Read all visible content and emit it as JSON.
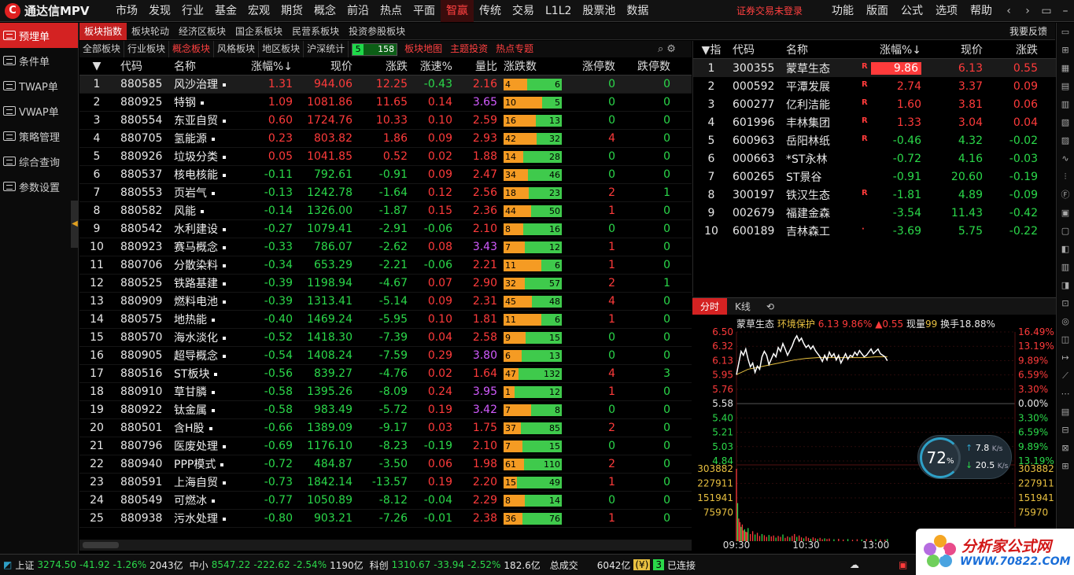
{
  "app": {
    "logo_glyph": "C",
    "title": "通达信MPV"
  },
  "menu": [
    "市场",
    "发现",
    "行业",
    "基金",
    "宏观",
    "期货",
    "概念",
    "前沿",
    "热点",
    "平面",
    "智赢",
    "传统",
    "交易",
    "L1L2",
    "股票池",
    "数据"
  ],
  "menu_active": 10,
  "login_text": "证券交易未登录",
  "right_menu": [
    "功能",
    "版面",
    "公式",
    "选项",
    "帮助"
  ],
  "window_controls": [
    "‹",
    "›",
    "▭",
    "–",
    "□",
    "✕"
  ],
  "sidebar": [
    "预埋单",
    "条件单",
    "TWAP单",
    "VWAP单",
    "策略管理",
    "综合查询",
    "参数设置"
  ],
  "sidebar_handle": "◀",
  "tabs1": [
    "板块指数",
    "板块轮动",
    "经济区板块",
    "国企系板块",
    "民营系板块",
    "投资参股板块"
  ],
  "feedback": "我要反馈",
  "tabs2": [
    "全部板块",
    "行业板块",
    "概念板块",
    "风格板块",
    "地区板块",
    "沪深统计"
  ],
  "tabs2_active": 2,
  "stat": {
    "up": "5",
    "down": "158"
  },
  "tabs2_right": [
    "板块地图",
    "主题投资",
    "热点专题"
  ],
  "tools2": [
    "⌕",
    "⚙"
  ],
  "sector": {
    "headers": [
      "",
      "代码",
      "名称",
      "涨幅%↓",
      "现价",
      "涨跌",
      "涨速%",
      "量比",
      "涨跌数",
      "涨停数",
      "跌停数"
    ],
    "sort_glyph": "▼",
    "rows": [
      [
        "1",
        "880585",
        "风沙治理",
        "1.31",
        "944.06",
        "12.25",
        "-0.43",
        "2.16",
        "4",
        "6",
        "0",
        "0"
      ],
      [
        "2",
        "880925",
        "特钢",
        "1.09",
        "1081.86",
        "11.65",
        "0.14",
        "3.65",
        "10",
        "5",
        "0",
        "0"
      ],
      [
        "3",
        "880554",
        "东亚自贸",
        "0.60",
        "1724.76",
        "10.33",
        "0.10",
        "2.59",
        "16",
        "13",
        "0",
        "0"
      ],
      [
        "4",
        "880705",
        "氢能源",
        "0.23",
        "803.82",
        "1.86",
        "0.09",
        "2.93",
        "42",
        "32",
        "4",
        "0"
      ],
      [
        "5",
        "880926",
        "垃圾分类",
        "0.05",
        "1041.85",
        "0.52",
        "0.02",
        "1.88",
        "14",
        "28",
        "0",
        "0"
      ],
      [
        "6",
        "880537",
        "核电核能",
        "-0.11",
        "792.61",
        "-0.91",
        "0.09",
        "2.47",
        "34",
        "46",
        "0",
        "0"
      ],
      [
        "7",
        "880553",
        "页岩气",
        "-0.13",
        "1242.78",
        "-1.64",
        "0.12",
        "2.56",
        "18",
        "23",
        "2",
        "1"
      ],
      [
        "8",
        "880582",
        "风能",
        "-0.14",
        "1326.00",
        "-1.87",
        "0.15",
        "2.36",
        "44",
        "50",
        "1",
        "0"
      ],
      [
        "9",
        "880542",
        "水利建设",
        "-0.27",
        "1079.41",
        "-2.91",
        "-0.06",
        "2.10",
        "8",
        "16",
        "0",
        "0"
      ],
      [
        "10",
        "880923",
        "赛马概念",
        "-0.33",
        "786.07",
        "-2.62",
        "0.08",
        "3.43",
        "7",
        "12",
        "1",
        "0"
      ],
      [
        "11",
        "880706",
        "分散染料",
        "-0.34",
        "653.29",
        "-2.21",
        "-0.06",
        "2.21",
        "11",
        "6",
        "1",
        "0"
      ],
      [
        "12",
        "880525",
        "铁路基建",
        "-0.39",
        "1198.94",
        "-4.67",
        "0.07",
        "2.90",
        "32",
        "57",
        "2",
        "1"
      ],
      [
        "13",
        "880909",
        "燃料电池",
        "-0.39",
        "1313.41",
        "-5.14",
        "0.09",
        "2.31",
        "45",
        "48",
        "4",
        "0"
      ],
      [
        "14",
        "880575",
        "地热能",
        "-0.40",
        "1469.24",
        "-5.95",
        "0.10",
        "1.81",
        "11",
        "6",
        "1",
        "0"
      ],
      [
        "15",
        "880570",
        "海水淡化",
        "-0.52",
        "1418.30",
        "-7.39",
        "0.04",
        "2.58",
        "9",
        "15",
        "0",
        "0"
      ],
      [
        "16",
        "880905",
        "超导概念",
        "-0.54",
        "1408.24",
        "-7.59",
        "0.29",
        "3.80",
        "6",
        "13",
        "0",
        "0"
      ],
      [
        "17",
        "880516",
        "ST板块",
        "-0.56",
        "839.27",
        "-4.76",
        "0.02",
        "1.64",
        "47",
        "132",
        "4",
        "3"
      ],
      [
        "18",
        "880910",
        "草甘膦",
        "-0.58",
        "1395.26",
        "-8.09",
        "0.24",
        "3.95",
        "1",
        "12",
        "1",
        "0"
      ],
      [
        "19",
        "880922",
        "钛金属",
        "-0.58",
        "983.49",
        "-5.72",
        "0.19",
        "3.42",
        "7",
        "8",
        "0",
        "0"
      ],
      [
        "20",
        "880501",
        "含H股",
        "-0.66",
        "1389.09",
        "-9.17",
        "0.03",
        "1.75",
        "37",
        "85",
        "2",
        "0"
      ],
      [
        "21",
        "880796",
        "医废处理",
        "-0.69",
        "1176.10",
        "-8.23",
        "-0.19",
        "2.10",
        "7",
        "15",
        "0",
        "0"
      ],
      [
        "22",
        "880940",
        "PPP模式",
        "-0.72",
        "484.87",
        "-3.50",
        "0.06",
        "1.98",
        "61",
        "110",
        "2",
        "0"
      ],
      [
        "23",
        "880591",
        "上海自贸",
        "-0.73",
        "1842.14",
        "-13.57",
        "0.19",
        "2.20",
        "15",
        "49",
        "1",
        "0"
      ],
      [
        "24",
        "880549",
        "可燃冰",
        "-0.77",
        "1050.89",
        "-8.12",
        "-0.04",
        "2.29",
        "8",
        "14",
        "0",
        "0"
      ],
      [
        "25",
        "880938",
        "污水处理",
        "-0.80",
        "903.21",
        "-7.26",
        "-0.01",
        "2.38",
        "36",
        "76",
        "1",
        "0"
      ]
    ]
  },
  "stocks": {
    "headers": [
      "▼指",
      "代码",
      "名称",
      "涨幅%↓",
      "现价",
      "涨跌"
    ],
    "r_mark": "R",
    "rows": [
      [
        "1",
        "300355",
        "蒙草生态",
        "9.86",
        "6.13",
        "0.55",
        "R"
      ],
      [
        "2",
        "000592",
        "平潭发展",
        "2.74",
        "3.37",
        "0.09",
        "R"
      ],
      [
        "3",
        "600277",
        "亿利洁能",
        "1.60",
        "3.81",
        "0.06",
        "R"
      ],
      [
        "4",
        "601996",
        "丰林集团",
        "1.33",
        "3.04",
        "0.04",
        "R"
      ],
      [
        "5",
        "600963",
        "岳阳林纸",
        "-0.46",
        "4.32",
        "-0.02",
        "R"
      ],
      [
        "6",
        "000663",
        "*ST永林",
        "-0.72",
        "4.16",
        "-0.03",
        ""
      ],
      [
        "7",
        "600265",
        "ST景谷",
        "-0.91",
        "20.60",
        "-0.19",
        ""
      ],
      [
        "8",
        "300197",
        "铁汉生态",
        "-1.81",
        "4.89",
        "-0.09",
        "R"
      ],
      [
        "9",
        "002679",
        "福建金森",
        "-3.54",
        "11.43",
        "-0.42",
        ""
      ],
      [
        "10",
        "600189",
        "吉林森工",
        "-3.69",
        "5.75",
        "-0.22",
        "·"
      ]
    ]
  },
  "chart_tabs": [
    "分时",
    "K线",
    "⟲"
  ],
  "chart_info": {
    "name": "蒙草生态",
    "sector": "环境保护",
    "price": "6.13",
    "pct": "9.86%",
    "chg": "▲0.55",
    "vol_label": "现量",
    "vol": "99",
    "turn_label": "换手",
    "turn": "18.88%"
  },
  "chart_data": {
    "type": "line",
    "title": "",
    "y_left": [
      "6.50",
      "6.32",
      "6.13",
      "5.95",
      "5.76",
      "5.58",
      "5.40",
      "5.21",
      "5.03",
      "4.84"
    ],
    "y_right": [
      "16.49%",
      "13.19%",
      "9.89%",
      "6.59%",
      "3.30%",
      "0.00%",
      "3.30%",
      "6.59%",
      "9.89%",
      "13.19%"
    ],
    "vol_left": [
      "303882",
      "227911",
      "151941",
      "75970"
    ],
    "vol_right": [
      "303882",
      "227911",
      "151941",
      "75970"
    ],
    "x_labels": [
      "09:30",
      "10:30",
      "13:00"
    ],
    "ylim": [
      4.84,
      6.5
    ],
    "x_range": [
      0,
      240
    ],
    "price_series": [
      [
        0,
        5.95
      ],
      [
        2,
        6.1
      ],
      [
        4,
        6.25
      ],
      [
        6,
        6.2
      ],
      [
        8,
        6.28
      ],
      [
        10,
        6.15
      ],
      [
        12,
        6.05
      ],
      [
        14,
        6.1
      ],
      [
        16,
        5.98
      ],
      [
        18,
        6.06
      ],
      [
        20,
        6.02
      ],
      [
        22,
        6.18
      ],
      [
        24,
        6.25
      ],
      [
        26,
        6.2
      ],
      [
        28,
        6.08
      ],
      [
        30,
        6.15
      ],
      [
        32,
        6.22
      ],
      [
        34,
        6.18
      ],
      [
        36,
        6.3
      ],
      [
        38,
        6.25
      ],
      [
        40,
        6.35
      ],
      [
        42,
        6.28
      ],
      [
        44,
        6.2
      ],
      [
        46,
        6.26
      ],
      [
        48,
        6.32
      ],
      [
        50,
        6.4
      ],
      [
        52,
        6.45
      ],
      [
        54,
        6.38
      ],
      [
        56,
        6.42
      ],
      [
        58,
        6.35
      ],
      [
        60,
        6.3
      ],
      [
        62,
        6.33
      ],
      [
        64,
        6.28
      ],
      [
        66,
        6.32
      ],
      [
        68,
        6.26
      ],
      [
        70,
        6.22
      ],
      [
        72,
        6.18
      ],
      [
        74,
        6.12
      ],
      [
        76,
        6.2
      ],
      [
        78,
        6.14
      ],
      [
        80,
        6.24
      ],
      [
        82,
        6.18
      ],
      [
        84,
        6.22
      ],
      [
        86,
        6.14
      ],
      [
        88,
        6.2
      ],
      [
        90,
        6.1
      ],
      [
        92,
        6.16
      ],
      [
        94,
        6.22
      ],
      [
        96,
        6.15
      ],
      [
        98,
        6.2
      ],
      [
        100,
        6.18
      ],
      [
        102,
        6.24
      ],
      [
        104,
        6.2
      ],
      [
        106,
        6.26
      ],
      [
        108,
        6.22
      ],
      [
        110,
        6.18
      ],
      [
        112,
        6.2
      ],
      [
        114,
        6.24
      ],
      [
        116,
        6.28
      ],
      [
        118,
        6.22
      ],
      [
        120,
        6.25
      ],
      [
        122,
        6.28
      ],
      [
        124,
        6.22
      ],
      [
        126,
        6.2
      ],
      [
        128,
        6.18
      ],
      [
        130,
        6.13
      ]
    ],
    "avg_series": [
      [
        0,
        5.95
      ],
      [
        10,
        6.02
      ],
      [
        20,
        6.05
      ],
      [
        30,
        6.08
      ],
      [
        40,
        6.11
      ],
      [
        50,
        6.14
      ],
      [
        60,
        6.16
      ],
      [
        70,
        6.17
      ],
      [
        80,
        6.17
      ],
      [
        90,
        6.17
      ],
      [
        100,
        6.17
      ],
      [
        110,
        6.17
      ],
      [
        120,
        6.18
      ],
      [
        130,
        6.18
      ]
    ],
    "volume_series": [
      [
        0,
        303882
      ],
      [
        1,
        160000
      ],
      [
        2,
        95000
      ],
      [
        3,
        80000
      ],
      [
        4,
        60000
      ],
      [
        5,
        70000
      ],
      [
        6,
        45000
      ],
      [
        7,
        50000
      ],
      [
        8,
        40000
      ],
      [
        9,
        38000
      ],
      [
        10,
        55000
      ],
      [
        12,
        30000
      ],
      [
        14,
        42000
      ],
      [
        16,
        28000
      ],
      [
        18,
        35000
      ],
      [
        20,
        22000
      ],
      [
        22,
        30000
      ],
      [
        24,
        25000
      ],
      [
        26,
        18000
      ],
      [
        28,
        26000
      ],
      [
        30,
        20000
      ],
      [
        32,
        24000
      ],
      [
        34,
        15000
      ],
      [
        36,
        22000
      ],
      [
        38,
        18000
      ],
      [
        40,
        28000
      ],
      [
        42,
        14000
      ],
      [
        44,
        20000
      ],
      [
        46,
        16000
      ],
      [
        48,
        22000
      ],
      [
        50,
        30000
      ],
      [
        52,
        18000
      ],
      [
        54,
        24000
      ],
      [
        56,
        16000
      ],
      [
        58,
        12000
      ],
      [
        60,
        20000
      ],
      [
        62,
        14000
      ],
      [
        64,
        10000
      ],
      [
        66,
        16000
      ],
      [
        68,
        12000
      ],
      [
        70,
        9000
      ],
      [
        72,
        14000
      ],
      [
        74,
        8000
      ],
      [
        76,
        12000
      ],
      [
        78,
        9000
      ],
      [
        80,
        11000
      ],
      [
        84,
        8000
      ],
      [
        88,
        10000
      ],
      [
        92,
        7000
      ],
      [
        96,
        9000
      ],
      [
        100,
        6000
      ],
      [
        104,
        8000
      ],
      [
        108,
        7000
      ],
      [
        112,
        9000
      ],
      [
        116,
        6000
      ],
      [
        120,
        8000
      ],
      [
        124,
        7000
      ],
      [
        128,
        6000
      ],
      [
        130,
        9000
      ]
    ]
  },
  "gauge": {
    "pct": "72",
    "unit": "%",
    "up": "7.8",
    "down": "20.5",
    "speed_unit": "K/s",
    "up_glyph": "↑",
    "down_glyph": "↓"
  },
  "status": {
    "sh_label": "上证",
    "sh": "3274.50",
    "sh_chg": "-41.92",
    "sh_pct": "-1.26%",
    "sh_amt": "2043亿",
    "zx_label": "中小",
    "zx": "8547.22",
    "zx_chg": "-222.62",
    "zx_pct": "-2.54%",
    "zx_amt": "1190亿",
    "kc_label": "科创",
    "kc": "1310.67",
    "kc_chg": "-33.94",
    "kc_pct": "-2.52%",
    "kc_amt": "182.6亿",
    "total_label": "总成交",
    "total": "6042亿",
    "conn_count": "3",
    "conn": "已连接"
  },
  "watermark": {
    "t1": "分析家公式网",
    "t2": "WWW.70822.COM"
  },
  "colors": {
    "up": "#ff3b3b",
    "down": "#2bd94a",
    "accent": "#d42222",
    "avg": "#e8c040",
    "flat": "#e8e8e8"
  }
}
